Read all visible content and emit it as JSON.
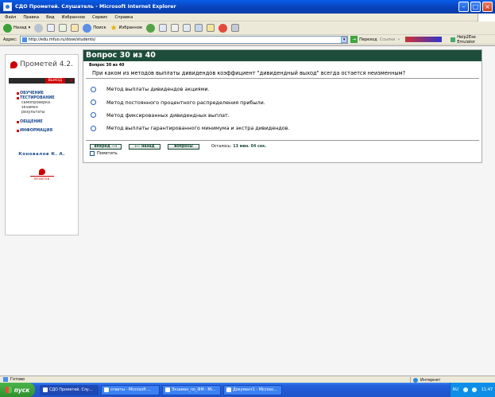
{
  "window": {
    "title": "СДО Прометей. Слушатель - Microsoft Internet Explorer"
  },
  "menubar": [
    "Файл",
    "Правка",
    "Вид",
    "Избранное",
    "Сервис",
    "Справка"
  ],
  "toolbar": {
    "back": "Назад",
    "search": "Поиск",
    "favorites": "Избранное"
  },
  "addressbar": {
    "label": "Адрес:",
    "url": "http://edu.mfuo.ru/dose/students/",
    "go": "Переход",
    "links": "Ссылки",
    "plugin": "Help2Exe Emulator"
  },
  "sidebar": {
    "logo": "Прометей 4.2.",
    "exit": "ВЫХОД",
    "menu": [
      {
        "label": "ОБУЧЕНИЕ"
      },
      {
        "label": "ТЕСТИРОВАНИЕ",
        "sub": [
          "самопроверка",
          "экзамен",
          "результаты"
        ]
      },
      {
        "label": "ОБЩЕНИЕ"
      },
      {
        "label": "ИНФОРМАЦИЯ"
      }
    ],
    "user": "Коновалов К. А.",
    "small_logo": "ПРОМЕТЕЙ"
  },
  "question": {
    "header": "Вопрос 30 из 40",
    "small": "Вопрос 30 из 40",
    "text": "При каком из методов выплаты дивидендов коэффициент \"дивидендный выход\" всегда остается неизменным?",
    "options": [
      "Метод выплаты дивидендов акциями.",
      "Метод постоянного процентного распределения прибыли.",
      "Метод фиксированных дивидендных выплат.",
      "Метод выплаты гарантированного минимума и экстра дивидендов."
    ],
    "btn_next": "вперед ⟶",
    "btn_back": "⟵ назад",
    "btn_questions": "вопросы",
    "remaining_label": "Осталось:",
    "remaining_value": "13 мин. 04 сек.",
    "mark_label": "Пометить"
  },
  "status": {
    "text": "Готово",
    "zone": "Интернет"
  },
  "taskbar": {
    "start": "пуск",
    "tasks": [
      "СДО Прометей. Слу...",
      "ответы - Microsoft ...",
      "Экзамен_по_ФМ - Mi...",
      "Документ1 - Microso..."
    ],
    "lang": "RU",
    "clock": "11:47"
  }
}
